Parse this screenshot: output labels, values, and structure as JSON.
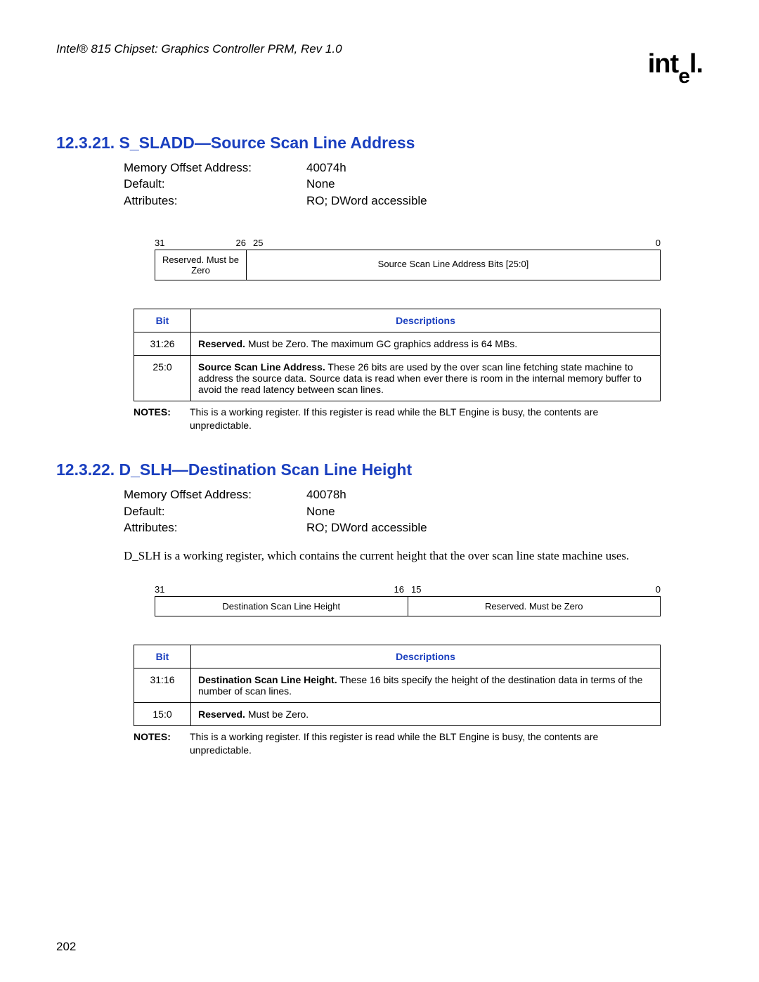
{
  "header": {
    "doc_title": "Intel® 815 Chipset: Graphics Controller PRM, Rev 1.0",
    "logo_text": "intel"
  },
  "section1": {
    "heading": "12.3.21. S_SLADD—Source Scan Line Address",
    "kv": {
      "k1": "Memory Offset Address:",
      "v1": "40074h",
      "k2": "Default:",
      "v2": "None",
      "k3": "Attributes:",
      "v3": "RO; DWord accessible"
    },
    "bitfield": {
      "l31": "31",
      "l26": "26",
      "l25": "25",
      "l0": "0",
      "cell1": "Reserved. Must be Zero",
      "cell2": "Source Scan Line Address Bits [25:0]"
    },
    "table": {
      "h_bit": "Bit",
      "h_desc": "Descriptions",
      "r1_bit": "31:26",
      "r1_desc_b": "Reserved.",
      "r1_desc": " Must be Zero. The maximum GC graphics address is 64 MBs.",
      "r2_bit": "25:0",
      "r2_desc_b": "Source Scan Line Address.",
      "r2_desc": " These 26 bits are used by the over scan line fetching state machine to address the source data. Source data is read when ever there is room in the internal memory buffer to avoid the read latency between scan lines."
    },
    "notes_label": "NOTES:",
    "notes": "This is a working register. If this register is read while the BLT Engine is busy, the contents are unpredictable."
  },
  "section2": {
    "heading": "12.3.22. D_SLH—Destination Scan Line Height",
    "kv": {
      "k1": "Memory Offset Address:",
      "v1": "40078h",
      "k2": "Default:",
      "v2": "None",
      "k3": "Attributes:",
      "v3": "RO; DWord accessible"
    },
    "body": "D_SLH is a working register, which contains the current height that the over scan line state machine uses.",
    "bitfield": {
      "l31": "31",
      "l16": "16",
      "l15": "15",
      "l0": "0",
      "cell1": "Destination Scan Line Height",
      "cell2": "Reserved. Must be Zero"
    },
    "table": {
      "h_bit": "Bit",
      "h_desc": "Descriptions",
      "r1_bit": "31:16",
      "r1_desc_b": "Destination Scan Line Height.",
      "r1_desc": " These 16 bits specify the height of the destination data in terms of the number of scan lines.",
      "r2_bit": "15:0",
      "r2_desc_b": "Reserved.",
      "r2_desc": " Must be Zero."
    },
    "notes_label": "NOTES:",
    "notes": "This is a working register. If this register is read while the BLT Engine is busy, the contents are unpredictable."
  },
  "page_number": "202"
}
